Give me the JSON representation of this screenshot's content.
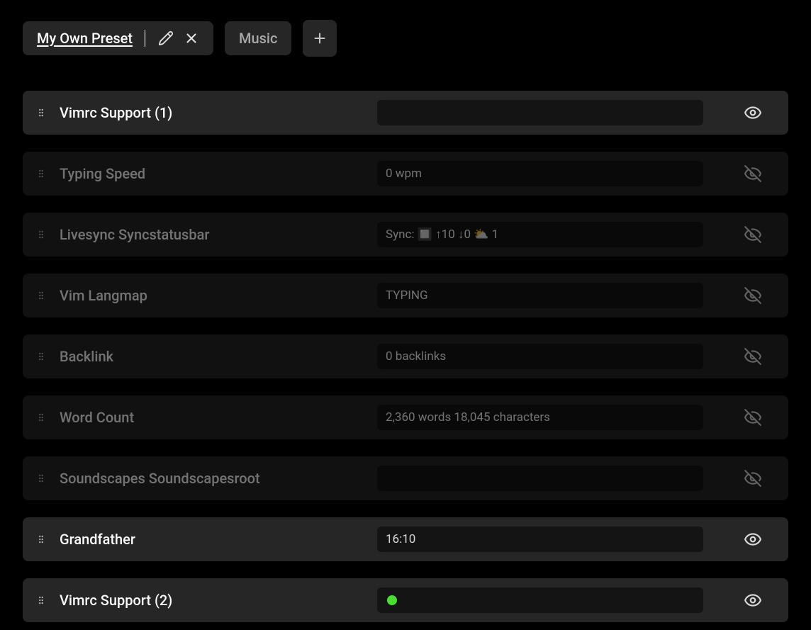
{
  "tabs": [
    {
      "label": "My Own Preset",
      "active": true,
      "editable": true
    },
    {
      "label": "Music",
      "active": false,
      "editable": false
    }
  ],
  "rows": [
    {
      "label": "Vimrc Support (1)",
      "value": "",
      "visible": true,
      "kind": "text"
    },
    {
      "label": "Typing Speed",
      "value": "0 wpm",
      "visible": false,
      "kind": "text"
    },
    {
      "label": "Livesync Syncstatusbar",
      "value": "Sync: 🔲 ↑10 ↓0  ⛅ 1",
      "visible": false,
      "kind": "text"
    },
    {
      "label": "Vim Langmap",
      "value": "TYPING",
      "visible": false,
      "kind": "text"
    },
    {
      "label": "Backlink",
      "value": "0 backlinks",
      "visible": false,
      "kind": "text"
    },
    {
      "label": "Word Count",
      "value": "2,360 words   18,045 characters",
      "visible": false,
      "kind": "text"
    },
    {
      "label": "Soundscapes Soundscapesroot",
      "value": "",
      "visible": false,
      "kind": "text"
    },
    {
      "label": "Grandfather",
      "value": "16:10",
      "visible": true,
      "kind": "text"
    },
    {
      "label": "Vimrc Support (2)",
      "value": "",
      "visible": true,
      "kind": "dot"
    }
  ]
}
